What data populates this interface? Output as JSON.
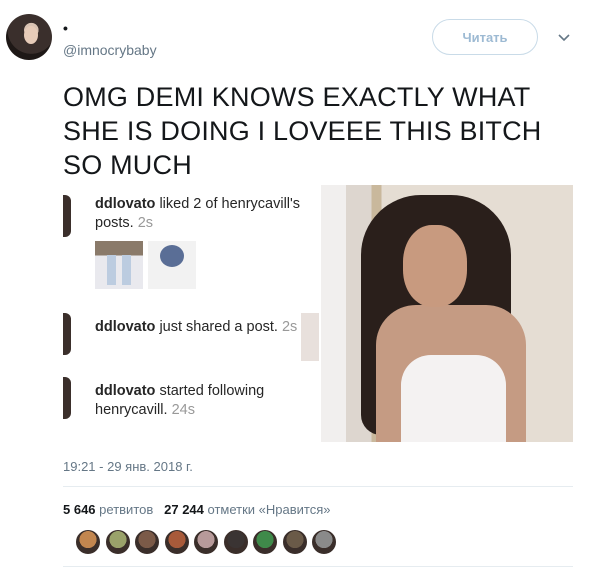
{
  "tweet": {
    "display_name": "•",
    "handle": "@imnocrybaby",
    "follow_label": "Читать",
    "text": "OMG DEMI KNOWS EXACTLY WHAT SHE IS DOING I LOVEEE THIS BITCH SO MUCH",
    "timestamp": "19:21 - 29 янв. 2018 г.",
    "retweets_count": "5 646",
    "retweets_label": "ретвитов",
    "likes_count": "27 244",
    "likes_label": "отметки «Нравится»"
  },
  "media": {
    "notifications": [
      {
        "user": "ddlovato",
        "text": " liked 2 of henrycavill's posts. ",
        "time": "2s"
      },
      {
        "user": "ddlovato",
        "text": " just shared a post. ",
        "time": "2s"
      },
      {
        "user": "ddlovato",
        "text": " started following henrycavill. ",
        "time": "24s"
      }
    ]
  },
  "likers": {
    "colors": [
      "#c2864f",
      "#9aa26a",
      "#7b5a48",
      "#a85a3a",
      "#b79a9a",
      "#3a3433",
      "#3f8a4a",
      "#6a5a48",
      "#8a8a8a"
    ]
  },
  "icons": {
    "menu": "chevron-down-icon"
  }
}
